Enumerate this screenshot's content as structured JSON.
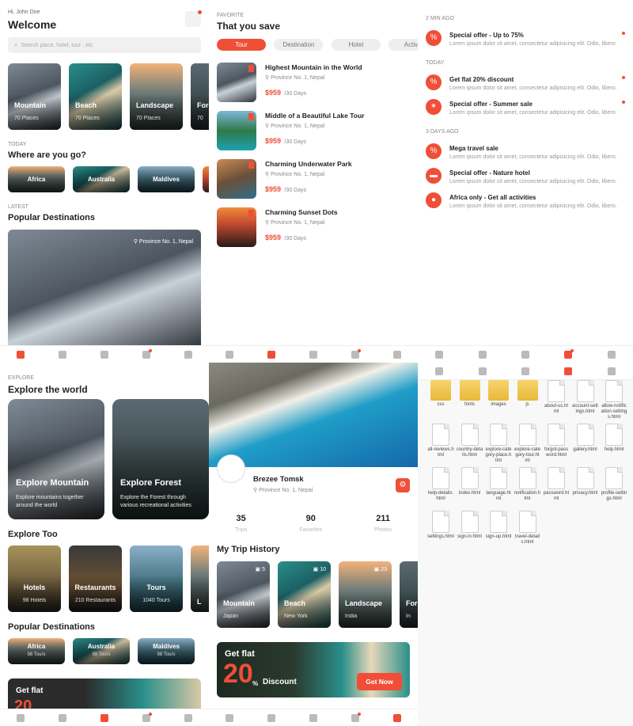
{
  "home": {
    "greeting": "Hi, John Doe",
    "title": "Welcome",
    "search_placeholder": "Search place, hotel, tour , etc",
    "categories": [
      {
        "name": "Mountain",
        "count": "70 Places"
      },
      {
        "name": "Beach",
        "count": "70 Places"
      },
      {
        "name": "Landscape",
        "count": "70 Places"
      },
      {
        "name": "Fore",
        "count": "70"
      }
    ],
    "where_kicker": "TODAY",
    "where_title": "Where are you go?",
    "countries": [
      "Africa",
      "Australia",
      "Maldives"
    ],
    "popular_kicker": "LATEST",
    "popular_title": "Popular Destinations",
    "featured_location": "Province No. 1, Nepal"
  },
  "favorite": {
    "kicker": "FAVORITE",
    "title": "That you save",
    "tabs": [
      "Tour",
      "Destination",
      "Hotel",
      "Activiti"
    ],
    "items": [
      {
        "title": "Highest Mountain in the World",
        "location": "Province No. 1, Nepal",
        "price": "$959",
        "duration": "/30 Days"
      },
      {
        "title": "Middle of a Beautiful Lake Tour",
        "location": "Province No. 1, Nepal",
        "price": "$959",
        "duration": "/30 Days"
      },
      {
        "title": "Charming Underwater Park",
        "location": "Province No. 1, Nepal",
        "price": "$959",
        "duration": "/30 Days"
      },
      {
        "title": "Charming Sunset Dots",
        "location": "Province No. 1, Nepal",
        "price": "$959",
        "duration": "/30 Days"
      }
    ]
  },
  "notifications": {
    "groups": [
      {
        "label": "2 MIN AGO",
        "items": [
          {
            "title": "Special offer - Up to 75%",
            "desc": "Lorem ipsum dolor sit amet, consectetur adipisicing elit. Odio, libero.",
            "icon": "%",
            "unread": true
          }
        ]
      },
      {
        "label": "TODAY",
        "items": [
          {
            "title": "Get flat 20% discount",
            "desc": "Lorem ipsum dolor sit amet, consectetur adipisicing elit. Odio, libero.",
            "icon": "%",
            "unread": true
          },
          {
            "title": "Special offer - Summer sale",
            "desc": "Lorem ipsum dolor sit amet, consectetur adipisicing elit. Odio, libero.",
            "icon": "✶",
            "unread": true
          }
        ]
      },
      {
        "label": "3 DAYS AGO",
        "items": [
          {
            "title": "Mega travel sale",
            "desc": "Lorem ipsum dolor sit amet, consectetur adipisicing elit. Odio, libero.",
            "icon": "%",
            "unread": false
          },
          {
            "title": "Special offer - Nature hotel",
            "desc": "Lorem ipsum dolor sit amet, consectetur adipisicing elit. Odio, libero.",
            "icon": "▬",
            "unread": false
          },
          {
            "title": "Africa only - Get all activities",
            "desc": "Lorem ipsum dolor sit amet, consectetur adipisicing elit. Odio, libero.",
            "icon": "●",
            "unread": false
          }
        ]
      }
    ]
  },
  "explore": {
    "kicker": "EXPLORE",
    "title": "Explore the world",
    "cards": [
      {
        "title": "Explore Mountain",
        "desc": "Explore mountains together around the world"
      },
      {
        "title": "Explore Forest",
        "desc": "Explore the Forest through various recreational activities"
      }
    ],
    "too_title": "Explore Too",
    "too": [
      {
        "name": "Hotels",
        "count": "98 Hotels"
      },
      {
        "name": "Restaurants",
        "count": "210 Restaurants"
      },
      {
        "name": "Tours",
        "count": "1040 Tours"
      },
      {
        "name": "L",
        "count": ""
      }
    ],
    "popular_title": "Popular Destinations",
    "popular": [
      {
        "name": "Africa",
        "count": "98 Tours"
      },
      {
        "name": "Australia",
        "count": "98 Tours"
      },
      {
        "name": "Maldives",
        "count": "98 Tours"
      }
    ],
    "promo_text": "Get flat",
    "promo_number": "20"
  },
  "profile": {
    "name": "Brezee Tomsk",
    "location": "Province No. 1, Nepal",
    "stats": [
      {
        "value": "35",
        "label": "Trips"
      },
      {
        "value": "90",
        "label": "Favorites"
      },
      {
        "value": "211",
        "label": "Photos"
      }
    ],
    "history_title": "My Trip History",
    "trips": [
      {
        "name": "Mountain",
        "place": "Japan",
        "count": "5"
      },
      {
        "name": "Beach",
        "place": "New York",
        "count": "10"
      },
      {
        "name": "Landscape",
        "place": "India",
        "count": "23"
      },
      {
        "name": "Fore",
        "place": "In",
        "count": ""
      }
    ],
    "promo_line1": "Get flat",
    "promo_number": "20",
    "promo_percent": "%",
    "promo_line2": "Discount",
    "promo_button": "Get Now"
  },
  "files": {
    "items": [
      {
        "name": "css",
        "type": "folder"
      },
      {
        "name": "fonts",
        "type": "folder"
      },
      {
        "name": "images",
        "type": "folder"
      },
      {
        "name": "js",
        "type": "folder"
      },
      {
        "name": "about-us.html",
        "type": "doc"
      },
      {
        "name": "account-settings.html",
        "type": "doc"
      },
      {
        "name": "allow-notification-settings.html",
        "type": "doc"
      },
      {
        "name": "all-reviews.html",
        "type": "doc"
      },
      {
        "name": "country-details.html",
        "type": "doc"
      },
      {
        "name": "explore-category-place.html",
        "type": "doc"
      },
      {
        "name": "explore-category-tour.html",
        "type": "doc"
      },
      {
        "name": "forgot-password.html",
        "type": "doc"
      },
      {
        "name": "gallery.html",
        "type": "doc"
      },
      {
        "name": "help.html",
        "type": "doc"
      },
      {
        "name": "help-details.html",
        "type": "doc"
      },
      {
        "name": "index.html",
        "type": "doc"
      },
      {
        "name": "language.html",
        "type": "doc"
      },
      {
        "name": "notification.html",
        "type": "doc"
      },
      {
        "name": "password.html",
        "type": "doc"
      },
      {
        "name": "privacy.html",
        "type": "doc"
      },
      {
        "name": "profile-settings.html",
        "type": "doc"
      },
      {
        "name": "settings.html",
        "type": "doc"
      },
      {
        "name": "sign-in.html",
        "type": "doc"
      },
      {
        "name": "sign-up.html",
        "type": "doc"
      },
      {
        "name": "travel-details.html",
        "type": "doc"
      }
    ]
  }
}
